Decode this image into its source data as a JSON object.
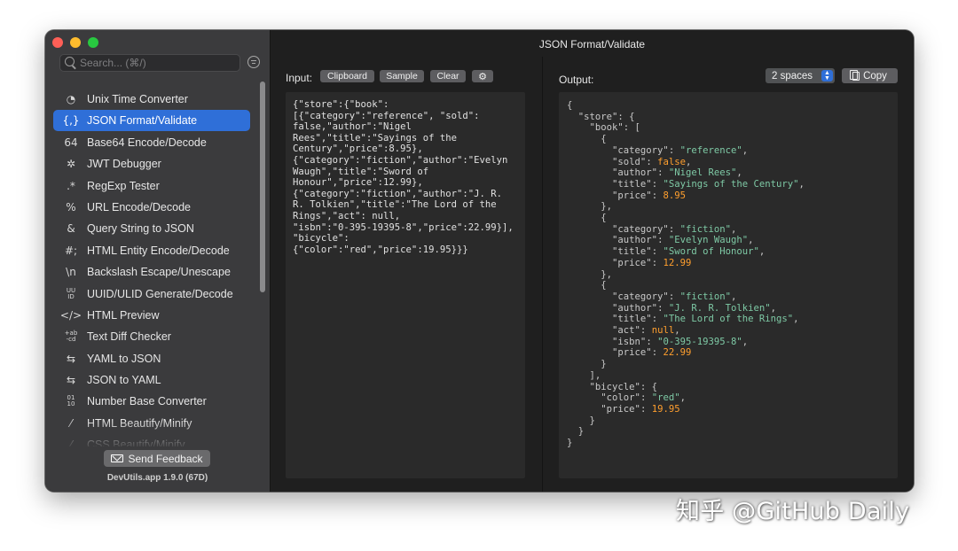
{
  "window": {
    "title": "JSON Format/Validate"
  },
  "sidebar": {
    "search_placeholder": "Search... (⌘/)",
    "tools": [
      {
        "label": "Unix Time Converter",
        "icon": "clock-icon",
        "glyph": "◔",
        "selected": false
      },
      {
        "label": "JSON Format/Validate",
        "icon": "json-braces-icon",
        "glyph": "{,}",
        "selected": true
      },
      {
        "label": "Base64 Encode/Decode",
        "icon": "base64-icon",
        "glyph": "64",
        "selected": false
      },
      {
        "label": "JWT Debugger",
        "icon": "jwt-icon",
        "glyph": "✲",
        "selected": false
      },
      {
        "label": "RegExp Tester",
        "icon": "regexp-icon",
        "glyph": ".*",
        "selected": false
      },
      {
        "label": "URL Encode/Decode",
        "icon": "percent-icon",
        "glyph": "%",
        "selected": false
      },
      {
        "label": "Query String to JSON",
        "icon": "ampersand-icon",
        "glyph": "&",
        "selected": false
      },
      {
        "label": "HTML Entity Encode/Decode",
        "icon": "hash-semicolon-icon",
        "glyph": "#;",
        "selected": false
      },
      {
        "label": "Backslash Escape/Unescape",
        "icon": "backslash-n-icon",
        "glyph": "\\n",
        "selected": false
      },
      {
        "label": "UUID/ULID Generate/Decode",
        "icon": "uuid-icon",
        "glyph": "UU ID",
        "selected": false
      },
      {
        "label": "HTML Preview",
        "icon": "code-brackets-icon",
        "glyph": "</>",
        "selected": false
      },
      {
        "label": "Text Diff Checker",
        "icon": "diff-icon",
        "glyph": "+ab -cd",
        "selected": false
      },
      {
        "label": "YAML to JSON",
        "icon": "convert-arrows-icon",
        "glyph": "⇆",
        "selected": false
      },
      {
        "label": "JSON to YAML",
        "icon": "convert-arrows-icon",
        "glyph": "⇆",
        "selected": false
      },
      {
        "label": "Number Base Converter",
        "icon": "number-base-icon",
        "glyph": "01 10",
        "selected": false
      },
      {
        "label": "HTML Beautify/Minify",
        "icon": "magic-wand-icon",
        "glyph": "⁄",
        "selected": false
      },
      {
        "label": "CSS Beautify/Minify",
        "icon": "magic-wand-icon",
        "glyph": "⁄",
        "selected": false
      }
    ],
    "feedback_label": "Send Feedback",
    "version": "DevUtils.app 1.9.0 (67D)"
  },
  "input": {
    "label": "Input:",
    "buttons": {
      "clipboard": "Clipboard",
      "sample": "Sample",
      "clear": "Clear"
    },
    "text_lines": [
      "{\"store\":{\"book\":",
      "[{\"category\":\"reference\", \"sold\":",
      "false,\"author\":\"Nigel",
      "Rees\",\"title\":\"Sayings of the",
      "Century\",\"price\":8.95},",
      "{\"category\":\"fiction\",\"author\":\"Evelyn",
      "Waugh\",\"title\":\"Sword of",
      "Honour\",\"price\":12.99},",
      "{\"category\":\"fiction\",\"author\":\"J. R.",
      "R. Tolkien\",\"title\":\"The Lord of the",
      "Rings\",\"act\": null,",
      "\"isbn\":\"0-395-19395-8\",\"price\":22.99}],",
      "\"bicycle\":",
      "{\"color\":\"red\",\"price\":19.95}}}"
    ]
  },
  "output": {
    "label": "Output:",
    "indent_option": "2 spaces",
    "copy_label": "Copy",
    "lines": [
      [
        {
          "t": "{",
          "c": "p"
        }
      ],
      [
        {
          "t": "  ",
          "c": "p"
        },
        {
          "t": "\"store\"",
          "c": "k"
        },
        {
          "t": ": {",
          "c": "p"
        }
      ],
      [
        {
          "t": "    ",
          "c": "p"
        },
        {
          "t": "\"book\"",
          "c": "k"
        },
        {
          "t": ": [",
          "c": "p"
        }
      ],
      [
        {
          "t": "      {",
          "c": "p"
        }
      ],
      [
        {
          "t": "        ",
          "c": "p"
        },
        {
          "t": "\"category\"",
          "c": "k"
        },
        {
          "t": ": ",
          "c": "p"
        },
        {
          "t": "\"reference\"",
          "c": "s"
        },
        {
          "t": ",",
          "c": "p"
        }
      ],
      [
        {
          "t": "        ",
          "c": "p"
        },
        {
          "t": "\"sold\"",
          "c": "k"
        },
        {
          "t": ": ",
          "c": "p"
        },
        {
          "t": "false",
          "c": "kw"
        },
        {
          "t": ",",
          "c": "p"
        }
      ],
      [
        {
          "t": "        ",
          "c": "p"
        },
        {
          "t": "\"author\"",
          "c": "k"
        },
        {
          "t": ": ",
          "c": "p"
        },
        {
          "t": "\"Nigel Rees\"",
          "c": "s"
        },
        {
          "t": ",",
          "c": "p"
        }
      ],
      [
        {
          "t": "        ",
          "c": "p"
        },
        {
          "t": "\"title\"",
          "c": "k"
        },
        {
          "t": ": ",
          "c": "p"
        },
        {
          "t": "\"Sayings of the Century\"",
          "c": "s"
        },
        {
          "t": ",",
          "c": "p"
        }
      ],
      [
        {
          "t": "        ",
          "c": "p"
        },
        {
          "t": "\"price\"",
          "c": "k"
        },
        {
          "t": ": ",
          "c": "p"
        },
        {
          "t": "8.95",
          "c": "n"
        }
      ],
      [
        {
          "t": "      },",
          "c": "p"
        }
      ],
      [
        {
          "t": "      {",
          "c": "p"
        }
      ],
      [
        {
          "t": "        ",
          "c": "p"
        },
        {
          "t": "\"category\"",
          "c": "k"
        },
        {
          "t": ": ",
          "c": "p"
        },
        {
          "t": "\"fiction\"",
          "c": "s"
        },
        {
          "t": ",",
          "c": "p"
        }
      ],
      [
        {
          "t": "        ",
          "c": "p"
        },
        {
          "t": "\"author\"",
          "c": "k"
        },
        {
          "t": ": ",
          "c": "p"
        },
        {
          "t": "\"Evelyn Waugh\"",
          "c": "s"
        },
        {
          "t": ",",
          "c": "p"
        }
      ],
      [
        {
          "t": "        ",
          "c": "p"
        },
        {
          "t": "\"title\"",
          "c": "k"
        },
        {
          "t": ": ",
          "c": "p"
        },
        {
          "t": "\"Sword of Honour\"",
          "c": "s"
        },
        {
          "t": ",",
          "c": "p"
        }
      ],
      [
        {
          "t": "        ",
          "c": "p"
        },
        {
          "t": "\"price\"",
          "c": "k"
        },
        {
          "t": ": ",
          "c": "p"
        },
        {
          "t": "12.99",
          "c": "n"
        }
      ],
      [
        {
          "t": "      },",
          "c": "p"
        }
      ],
      [
        {
          "t": "      {",
          "c": "p"
        }
      ],
      [
        {
          "t": "        ",
          "c": "p"
        },
        {
          "t": "\"category\"",
          "c": "k"
        },
        {
          "t": ": ",
          "c": "p"
        },
        {
          "t": "\"fiction\"",
          "c": "s"
        },
        {
          "t": ",",
          "c": "p"
        }
      ],
      [
        {
          "t": "        ",
          "c": "p"
        },
        {
          "t": "\"author\"",
          "c": "k"
        },
        {
          "t": ": ",
          "c": "p"
        },
        {
          "t": "\"J. R. R. Tolkien\"",
          "c": "s"
        },
        {
          "t": ",",
          "c": "p"
        }
      ],
      [
        {
          "t": "        ",
          "c": "p"
        },
        {
          "t": "\"title\"",
          "c": "k"
        },
        {
          "t": ": ",
          "c": "p"
        },
        {
          "t": "\"The Lord of the Rings\"",
          "c": "s"
        },
        {
          "t": ",",
          "c": "p"
        }
      ],
      [
        {
          "t": "        ",
          "c": "p"
        },
        {
          "t": "\"act\"",
          "c": "k"
        },
        {
          "t": ": ",
          "c": "p"
        },
        {
          "t": "null",
          "c": "kw"
        },
        {
          "t": ",",
          "c": "p"
        }
      ],
      [
        {
          "t": "        ",
          "c": "p"
        },
        {
          "t": "\"isbn\"",
          "c": "k"
        },
        {
          "t": ": ",
          "c": "p"
        },
        {
          "t": "\"0-395-19395-8\"",
          "c": "s"
        },
        {
          "t": ",",
          "c": "p"
        }
      ],
      [
        {
          "t": "        ",
          "c": "p"
        },
        {
          "t": "\"price\"",
          "c": "k"
        },
        {
          "t": ": ",
          "c": "p"
        },
        {
          "t": "22.99",
          "c": "n"
        }
      ],
      [
        {
          "t": "      }",
          "c": "p"
        }
      ],
      [
        {
          "t": "    ],",
          "c": "p"
        }
      ],
      [
        {
          "t": "    ",
          "c": "p"
        },
        {
          "t": "\"bicycle\"",
          "c": "k"
        },
        {
          "t": ": {",
          "c": "p"
        }
      ],
      [
        {
          "t": "      ",
          "c": "p"
        },
        {
          "t": "\"color\"",
          "c": "k"
        },
        {
          "t": ": ",
          "c": "p"
        },
        {
          "t": "\"red\"",
          "c": "s"
        },
        {
          "t": ",",
          "c": "p"
        }
      ],
      [
        {
          "t": "      ",
          "c": "p"
        },
        {
          "t": "\"price\"",
          "c": "k"
        },
        {
          "t": ": ",
          "c": "p"
        },
        {
          "t": "19.95",
          "c": "n"
        }
      ],
      [
        {
          "t": "    }",
          "c": "p"
        }
      ],
      [
        {
          "t": "  }",
          "c": "p"
        }
      ],
      [
        {
          "t": "}",
          "c": "p"
        }
      ]
    ]
  },
  "watermark": "知乎 @GitHub Daily",
  "colors": {
    "accent": "#2f6fd8",
    "string": "#7ec9a5",
    "number": "#ff9f2e",
    "key": "#c8c8c8"
  }
}
